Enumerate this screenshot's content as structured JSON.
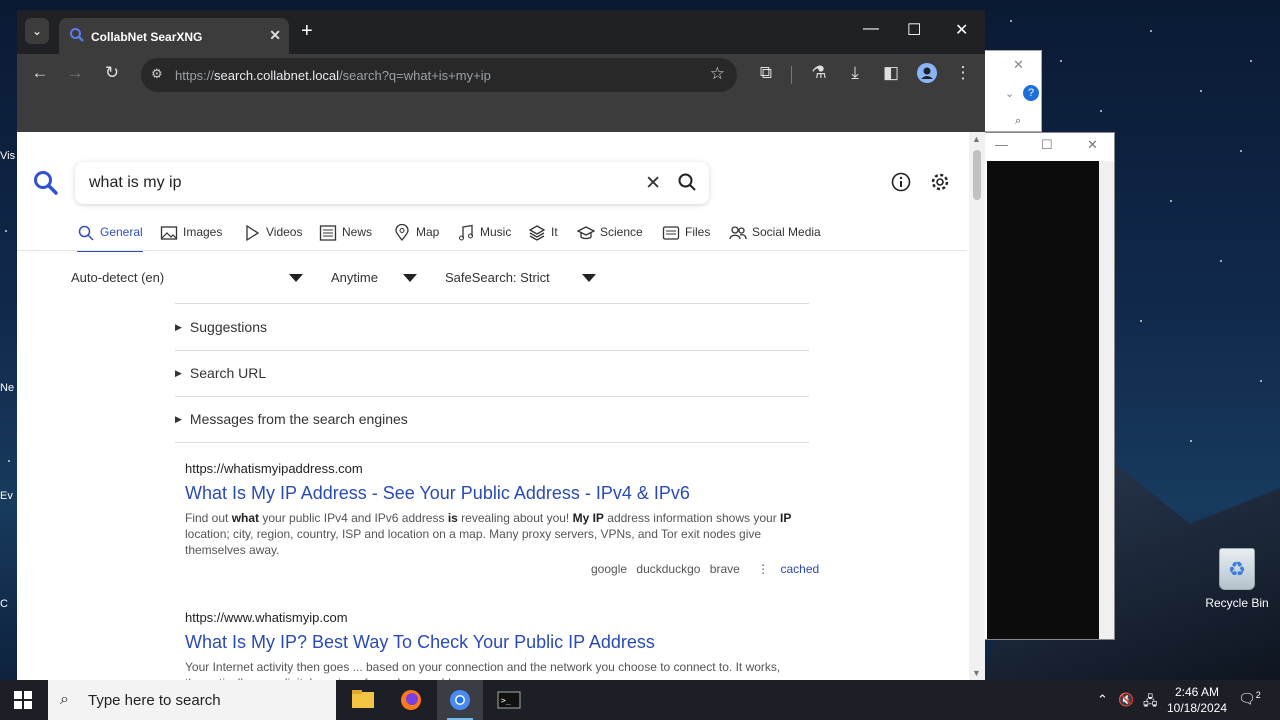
{
  "desktop": {
    "left_fragments": [
      "Vis",
      "Ne",
      "Ev",
      "C"
    ],
    "recycle_bin_label": "Recycle Bin"
  },
  "browser": {
    "tab": {
      "title": "CollabNet SearXNG",
      "close": "✕"
    },
    "new_tab": "+",
    "window_controls": {
      "minimize": "—",
      "maximize": "☐",
      "close": "✕"
    },
    "address": {
      "scheme": "https://",
      "host": "search.collabnet.local",
      "path": "/search?q=what+is+my+ip"
    }
  },
  "search": {
    "query": "what is my ip",
    "categories": [
      {
        "label": "General",
        "icon": "search-icon",
        "active": true
      },
      {
        "label": "Images",
        "icon": "image-icon"
      },
      {
        "label": "Videos",
        "icon": "play-icon"
      },
      {
        "label": "News",
        "icon": "newspaper-icon"
      },
      {
        "label": "Map",
        "icon": "map-pin-icon"
      },
      {
        "label": "Music",
        "icon": "music-note-icon"
      },
      {
        "label": "It",
        "icon": "layers-icon"
      },
      {
        "label": "Science",
        "icon": "school-icon"
      },
      {
        "label": "Files",
        "icon": "file-tray-icon"
      },
      {
        "label": "Social Media",
        "icon": "people-icon"
      }
    ],
    "filters": {
      "language": "Auto-detect (en)",
      "time": "Anytime",
      "safesearch": "SafeSearch: Strict"
    },
    "details": [
      "Suggestions",
      "Search URL",
      "Messages from the search engines"
    ]
  },
  "results": [
    {
      "url": "https://whatismyipaddress.com",
      "title": "What Is My IP Address - See Your Public Address - IPv4 & IPv6",
      "snippet_parts": [
        {
          "t": "Find out "
        },
        {
          "t": "what",
          "b": true
        },
        {
          "t": " your public IPv4 and IPv6 address "
        },
        {
          "t": "is",
          "b": true
        },
        {
          "t": " revealing about you! "
        },
        {
          "t": "My IP",
          "b": true
        },
        {
          "t": " address information shows your "
        },
        {
          "t": "IP",
          "b": true
        },
        {
          "t": " location; city, region, country, ISP and location on a map. Many proxy servers, VPNs, and Tor exit nodes give themselves away."
        }
      ],
      "engines": [
        "google",
        "duckduckgo",
        "brave"
      ],
      "cached": "cached"
    },
    {
      "url": "https://www.whatismyip.com",
      "title": "What Is My IP? Best Way To Check Your Public IP Address",
      "snippet_parts": [
        {
          "t": "Your Internet activity then goes ... based on your connection and the network you choose to connect to. It works, theoretically, as a digital version of your home address...."
        }
      ]
    }
  ],
  "taskbar": {
    "search_placeholder": "Type here to search",
    "time": "2:46 AM",
    "date": "10/18/2024",
    "notification_count": "2"
  }
}
